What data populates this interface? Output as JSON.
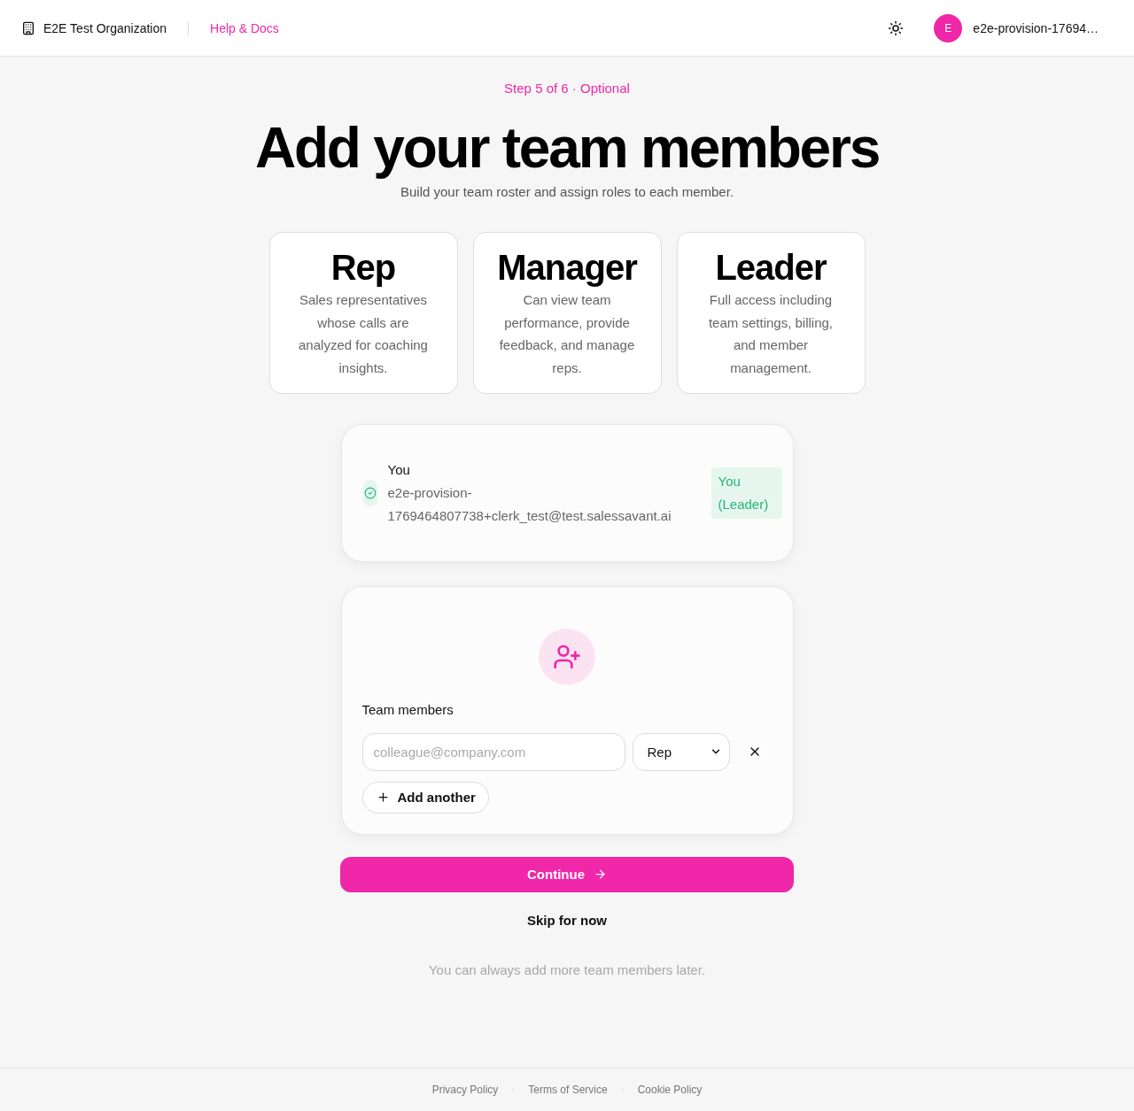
{
  "header": {
    "organization": "E2E Test Organization",
    "help_link": "Help & Docs",
    "avatar_initial": "E",
    "user_name": "e2e-provision-17694…"
  },
  "step": "Step 5 of 6 · Optional",
  "title": "Add your team members",
  "subtitle": "Build your team roster and assign roles to each member.",
  "roles": [
    {
      "name": "Rep",
      "description": "Sales representatives whose calls are analyzed for coaching insights."
    },
    {
      "name": "Manager",
      "description": "Can view team performance, provide feedback, and manage reps."
    },
    {
      "name": "Leader",
      "description": "Full access including team settings, billing, and member management."
    }
  ],
  "current_user": {
    "name": "You",
    "email": "e2e-provision-1769464807738+clerk_test@test.salessavant.ai",
    "badge": "You (Leader)"
  },
  "team_members": {
    "label": "Team members",
    "rows": [
      {
        "placeholder": "colleague@company.com",
        "role": "Rep"
      }
    ],
    "add_button": "Add another"
  },
  "continue_button": "Continue",
  "skip_link": "Skip for now",
  "note": "You can always add more team members later.",
  "footer": {
    "links": [
      "Privacy Policy",
      "Terms of Service",
      "Cookie Policy"
    ]
  }
}
